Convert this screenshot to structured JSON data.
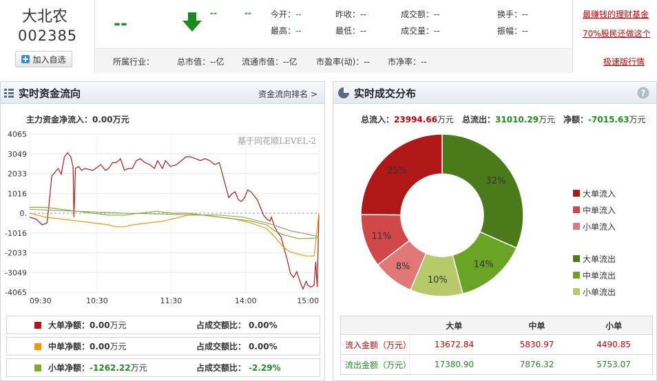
{
  "stock": {
    "name": "大北农",
    "code": "002385",
    "add_label": "加入自选"
  },
  "quote": {
    "price": "--",
    "change": "--",
    "change_pct": "--",
    "open_label": "今开：",
    "open": "--",
    "prev_close_label": "昨收：",
    "prev_close": "--",
    "amount_label": "成交额：",
    "amount": "--",
    "turnover_label": "换手：",
    "turnover": "--",
    "high_label": "最高：",
    "high": "--",
    "low_label": "最低：",
    "low": "--",
    "volume_label": "成交量：",
    "volume": "--",
    "amplitude_label": "振幅：",
    "amplitude": "--"
  },
  "info_bar": {
    "industry": "所属行业：",
    "market_cap": "总市值：--亿",
    "float_cap": "流通市值：--亿",
    "pe": "市盈率(动)：--",
    "pb": "市净率：--"
  },
  "ads": {
    "link1": "最赚钱的理财基金",
    "link2": "70%股民还做这个",
    "link3": "极速版行情"
  },
  "left_panel": {
    "title": "实时资金流向",
    "rank_link": "资金流向排名 >",
    "net_inflow_label": "主力资金净流入：",
    "net_inflow_value": "0.00",
    "net_inflow_unit": "万元",
    "watermark": "基于同花顺LEVEL-2",
    "legend": [
      {
        "label": "大单净额：",
        "value": "0.00",
        "unit": "万元",
        "ratio_label": "占成交额比：",
        "ratio": "0.00%",
        "color": "#b01818"
      },
      {
        "label": "中单净额：",
        "value": "0.00",
        "unit": "万元",
        "ratio_label": "占成交额比：",
        "ratio": "0.00%",
        "color": "#f39800"
      },
      {
        "label": "小单净额：",
        "value": "-1262.22",
        "unit": "万元",
        "ratio_label": "占成交额比：",
        "ratio": "-2.29%",
        "color": "#7cab2b"
      }
    ]
  },
  "right_panel": {
    "title": "实时成交分布",
    "total_in_label": "总流入：",
    "total_in": "23994.66",
    "total_in_unit": "万元",
    "total_out_label": "总流出：",
    "total_out": "31010.29",
    "total_out_unit": "万元",
    "net_label": "净额：",
    "net": "-7015.63",
    "net_unit": "万元",
    "table": {
      "headers": [
        "",
        "大单",
        "中单",
        "小单"
      ],
      "rows": [
        {
          "label": "流入金额（万元）",
          "values": [
            "13672.84",
            "5830.97",
            "4490.85"
          ]
        },
        {
          "label": "流出金额（万元）",
          "values": [
            "17380.90",
            "7876.32",
            "5753.07"
          ]
        }
      ]
    }
  },
  "chart_data": [
    {
      "type": "line",
      "title": "",
      "x_ticks": [
        "09:30",
        "10:30",
        "11:30",
        "14:00",
        "15:00"
      ],
      "y_ticks": [
        "4065",
        "3049",
        "2033",
        "1016",
        "0.",
        "-1016",
        "-2033",
        "-3049",
        "-4065"
      ],
      "ylim": [
        -4065,
        4065
      ],
      "grid": true,
      "series": [
        {
          "name": "大单净额",
          "color": "#b01818",
          "values": [
            [
              0,
              -200
            ],
            [
              8,
              -300
            ],
            [
              16,
              -600
            ],
            [
              22,
              -500
            ],
            [
              24,
              200
            ],
            [
              28,
              1900
            ],
            [
              36,
              2300
            ],
            [
              40,
              2000
            ],
            [
              44,
              2900
            ],
            [
              48,
              3100
            ],
            [
              52,
              2900
            ],
            [
              55,
              2400
            ],
            [
              56,
              -200
            ],
            [
              58,
              2300
            ],
            [
              62,
              2400
            ],
            [
              66,
              2200
            ],
            [
              70,
              2300
            ],
            [
              80,
              2200
            ],
            [
              90,
              2500
            ],
            [
              96,
              2200
            ],
            [
              100,
              2300
            ],
            [
              105,
              2600
            ],
            [
              110,
              2600
            ],
            [
              115,
              2800
            ],
            [
              120,
              2200
            ],
            [
              125,
              2300
            ],
            [
              130,
              2300
            ],
            [
              135,
              2700
            ],
            [
              140,
              2800
            ],
            [
              146,
              2600
            ],
            [
              152,
              2500
            ],
            [
              158,
              2300
            ],
            [
              162,
              2700
            ],
            [
              168,
              2300
            ],
            [
              172,
              2700
            ],
            [
              178,
              2400
            ],
            [
              186,
              2500
            ],
            [
              192,
              2700
            ],
            [
              198,
              2900
            ],
            [
              204,
              2900
            ],
            [
              210,
              2800
            ],
            [
              216,
              2700
            ],
            [
              222,
              2800
            ],
            [
              228,
              2700
            ],
            [
              234,
              2500
            ],
            [
              240,
              2600
            ],
            [
              244,
              2000
            ],
            [
              248,
              1400
            ],
            [
              252,
              800
            ],
            [
              256,
              1000
            ],
            [
              260,
              1100
            ],
            [
              264,
              700
            ],
            [
              268,
              600
            ],
            [
              272,
              800
            ],
            [
              276,
              1200
            ],
            [
              280,
              1100
            ],
            [
              284,
              900
            ],
            [
              288,
              700
            ],
            [
              292,
              300
            ],
            [
              296,
              -100
            ],
            [
              300,
              -300
            ],
            [
              304,
              -400
            ],
            [
              306,
              -200
            ],
            [
              310,
              -700
            ],
            [
              314,
              -1000
            ],
            [
              318,
              -1200
            ],
            [
              322,
              -1800
            ],
            [
              326,
              -2400
            ],
            [
              330,
              -3100
            ],
            [
              334,
              -3300
            ],
            [
              338,
              -3000
            ],
            [
              342,
              -3500
            ],
            [
              346,
              -3900
            ],
            [
              350,
              -3500
            ],
            [
              352,
              -3700
            ],
            [
              356,
              -3800
            ],
            [
              360,
              -3700
            ],
            [
              362,
              -2500
            ],
            [
              364,
              -3800
            ],
            [
              366,
              0
            ]
          ]
        },
        {
          "name": "中单净额",
          "color": "#f39800",
          "values": [
            [
              0,
              0
            ],
            [
              10,
              -100
            ],
            [
              20,
              -200
            ],
            [
              40,
              -300
            ],
            [
              60,
              -400
            ],
            [
              80,
              -500
            ],
            [
              100,
              -600
            ],
            [
              110,
              -700
            ],
            [
              120,
              -700
            ],
            [
              130,
              -600
            ],
            [
              150,
              -500
            ],
            [
              170,
              -400
            ],
            [
              180,
              -300
            ],
            [
              190,
              -200
            ],
            [
              200,
              -100
            ],
            [
              220,
              -100
            ],
            [
              240,
              -200
            ],
            [
              260,
              -300
            ],
            [
              280,
              -500
            ],
            [
              300,
              -800
            ],
            [
              310,
              -1200
            ],
            [
              320,
              -1700
            ],
            [
              330,
              -2000
            ],
            [
              340,
              -2100
            ],
            [
              350,
              -2200
            ],
            [
              360,
              -2200
            ],
            [
              366,
              0
            ]
          ]
        },
        {
          "name": "小单净额",
          "color": "#7cab2b",
          "values": [
            [
              0,
              300
            ],
            [
              20,
              300
            ],
            [
              40,
              200
            ],
            [
              60,
              100
            ],
            [
              80,
              0
            ],
            [
              100,
              -100
            ],
            [
              120,
              -100
            ],
            [
              140,
              0
            ],
            [
              160,
              100
            ],
            [
              180,
              0
            ],
            [
              200,
              0
            ],
            [
              220,
              -100
            ],
            [
              240,
              -200
            ],
            [
              260,
              -300
            ],
            [
              280,
              -400
            ],
            [
              300,
              -600
            ],
            [
              310,
              -900
            ],
            [
              320,
              -1100
            ],
            [
              330,
              -1200
            ],
            [
              340,
              -1300
            ],
            [
              350,
              -1300
            ],
            [
              366,
              -1262
            ]
          ]
        },
        {
          "name": "主力净流入",
          "color": "#9aa06c",
          "values": [
            [
              0,
              200
            ],
            [
              30,
              150
            ],
            [
              60,
              100
            ],
            [
              90,
              50
            ],
            [
              120,
              0
            ],
            [
              150,
              -30
            ],
            [
              180,
              -60
            ],
            [
              210,
              -80
            ],
            [
              240,
              -100
            ],
            [
              270,
              -200
            ],
            [
              300,
              -500
            ],
            [
              330,
              -900
            ],
            [
              366,
              -1200
            ]
          ]
        }
      ]
    },
    {
      "type": "pie",
      "title": "",
      "categories": [
        "大单流入",
        "中单流入",
        "小单流入",
        "大单流出",
        "中单流出",
        "小单流出"
      ],
      "values": [
        13672.84,
        5830.97,
        4490.85,
        17380.9,
        7876.32,
        5753.07
      ],
      "labels": [
        "25%",
        "11%",
        "8%",
        "32%",
        "14%",
        "10%"
      ],
      "colors": [
        "#b01818",
        "#d04848",
        "#e07878",
        "#4b7a1a",
        "#6aa424",
        "#b8c96a"
      ],
      "legend": "right"
    }
  ]
}
